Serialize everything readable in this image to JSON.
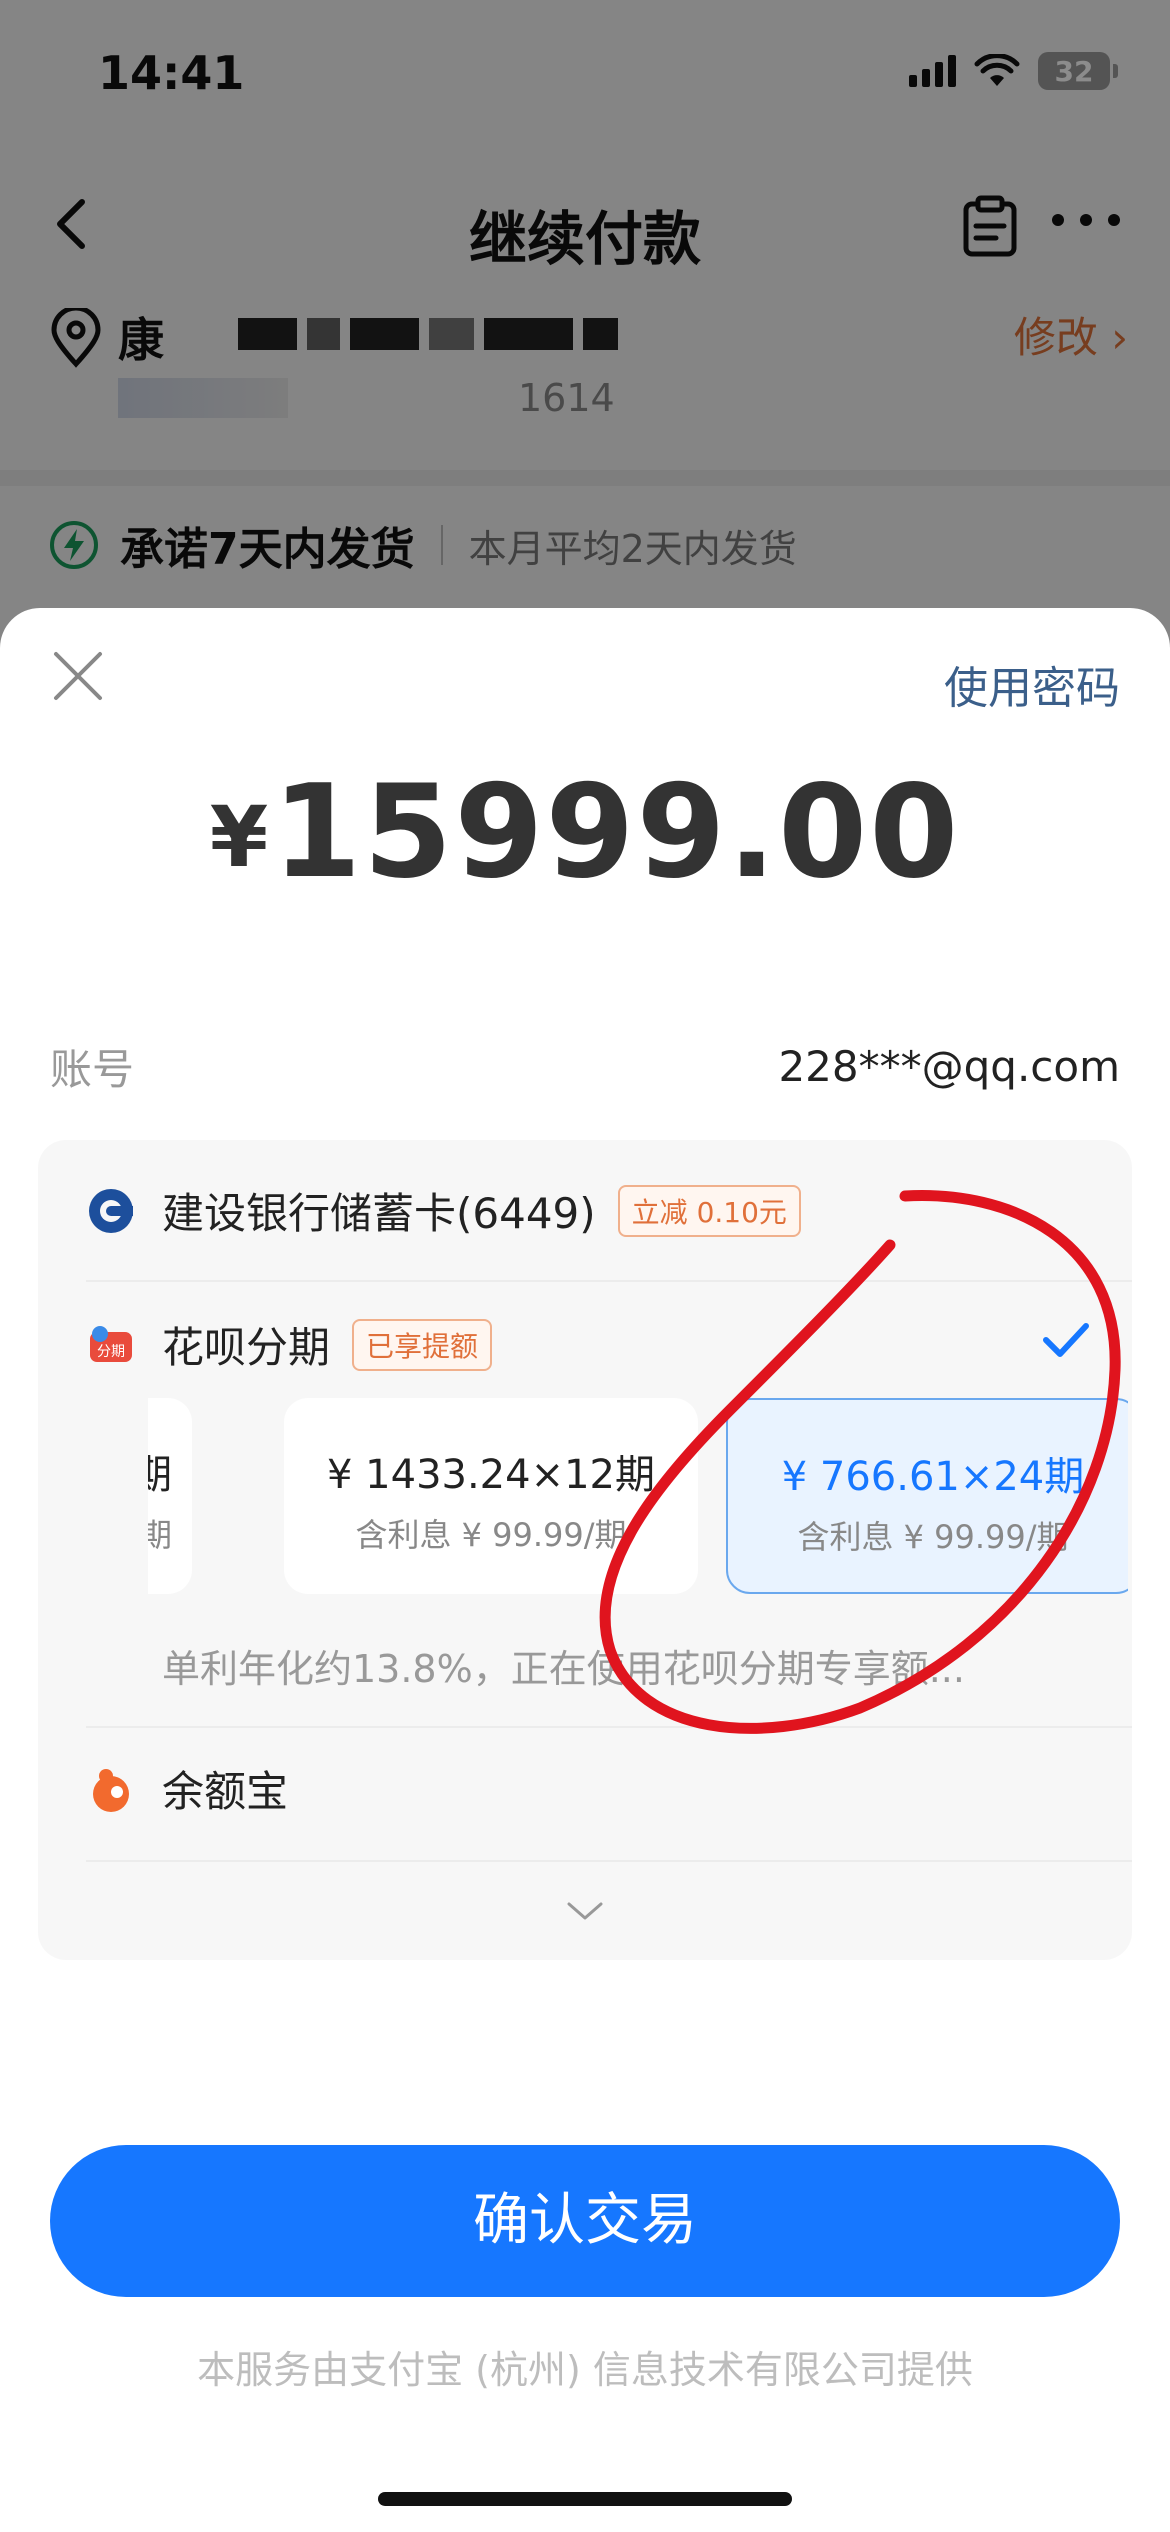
{
  "status": {
    "time": "14:41",
    "battery": "32"
  },
  "header": {
    "title": "继续付款"
  },
  "address": {
    "name_visible": "康",
    "contact": "1614",
    "edit_label": "修改 ›"
  },
  "shipping": {
    "promise": "承诺7天内发货",
    "average": "本月平均2天内发货"
  },
  "sheet": {
    "use_password": "使用密码",
    "currency": "¥",
    "amount": "15999.00",
    "account_label": "账号",
    "account_value": "228***@qq.com",
    "methods": [
      {
        "name": "建设银行储蓄卡(6449)",
        "badge": "立减 0.10元",
        "icon": "ccb-bank-icon"
      },
      {
        "name": "花呗分期",
        "badge": "已享提额",
        "icon": "huabei-icon",
        "selected": true
      },
      {
        "name": "余额宝",
        "icon": "yuebao-icon"
      }
    ],
    "plans": [
      {
        "title": "期",
        "sub": "期"
      },
      {
        "title": "¥ 1433.24×12期",
        "sub": "含利息 ¥ 99.99/期"
      },
      {
        "title": "¥ 766.61×24期",
        "sub": "含利息 ¥ 99.99/期",
        "selected": true
      }
    ],
    "rate_note": "单利年化约13.8%，正在使用花呗分期专享额...",
    "confirm_label": "确认交易",
    "footer": "本服务由支付宝 (杭州) 信息技术有限公司提供"
  },
  "colors": {
    "primary": "#1677ff",
    "accent": "#e0703a",
    "annotation": "#e0141e"
  }
}
